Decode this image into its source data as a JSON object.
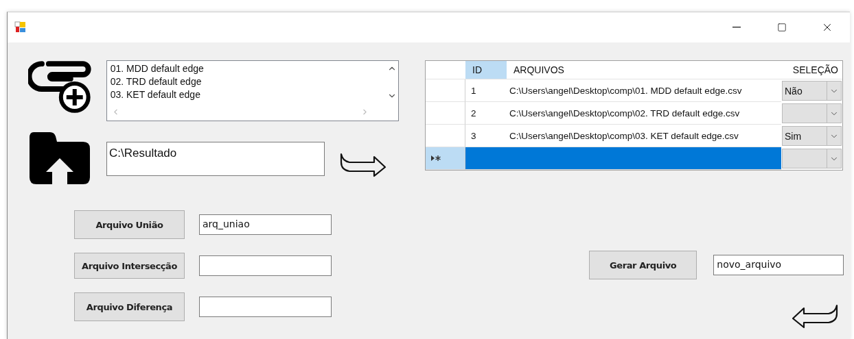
{
  "file_list": {
    "items": [
      "01. MDD default edge",
      "02. TRD default edge",
      "03. KET default edge"
    ]
  },
  "output_folder": {
    "value": "C:\\Resultado"
  },
  "operations": [
    {
      "label": "Arquivo União",
      "value": "arq_uniao"
    },
    {
      "label": "Arquivo Intersecção"
    },
    {
      "label": "Arquivo Diferença"
    }
  ],
  "table": {
    "columns": [
      "ID",
      "ARQUIVOS",
      "SELEÇÃO"
    ],
    "rows": [
      {
        "id": "1",
        "file": "C:\\Users\\angel\\Desktop\\comp\\01. MDD default edge.csv",
        "selection": "Não",
        "selected": false
      },
      {
        "id": "2",
        "file": "C:\\Users\\angel\\Desktop\\comp\\02. TRD default edge.csv",
        "selected": false
      },
      {
        "id": "3",
        "file": "C:\\Users\\angel\\Desktop\\comp\\03. KET default edge.csv",
        "selection": "Sim",
        "selected": false
      },
      {
        "kind": "new",
        "selected": true
      }
    ]
  },
  "generate": {
    "label": "Gerar Arquivo",
    "value": "novo_arquivo"
  }
}
